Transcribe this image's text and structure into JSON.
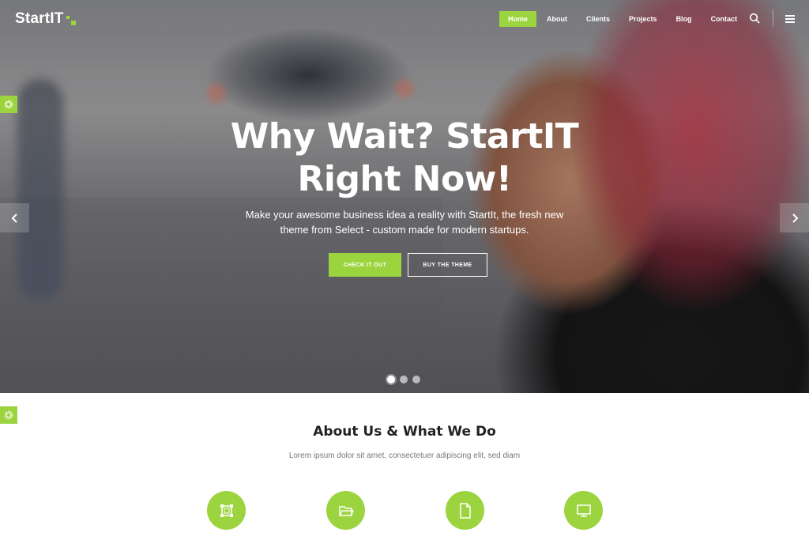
{
  "brand": {
    "name": "StartIT",
    "accent": "#9bd43e"
  },
  "nav": {
    "items": [
      {
        "label": "Home",
        "active": true
      },
      {
        "label": "About"
      },
      {
        "label": "Clients"
      },
      {
        "label": "Projects"
      },
      {
        "label": "Blog"
      },
      {
        "label": "Contact"
      }
    ],
    "icons": [
      "search-icon",
      "menu-icon"
    ]
  },
  "hero": {
    "title_line1": "Why Wait? StartIT",
    "title_line2": "Right Now!",
    "subtitle_line1": "Make your awesome business idea a reality with StartIt, the fresh new",
    "subtitle_line2": "theme from Select - custom made for modern startups.",
    "primary_button": "CHECK IT OUT",
    "secondary_button": "BUY THE THEME",
    "slides": 3,
    "active_slide": 1
  },
  "about": {
    "title": "About Us & What We Do",
    "subtitle": "Lorem ipsum dolor sit amet, consectetuer adipiscing elit, sed diam",
    "features": [
      "frame-icon",
      "folder-icon",
      "document-icon",
      "monitor-icon"
    ]
  }
}
